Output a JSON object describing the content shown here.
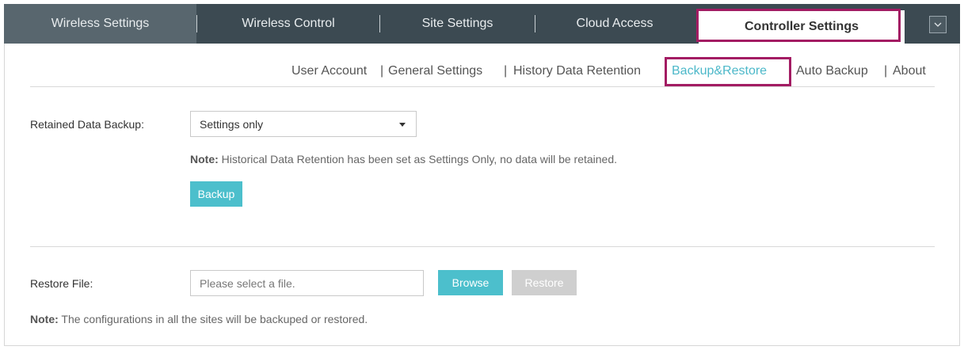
{
  "top_tabs": [
    {
      "label": "Wireless Settings"
    },
    {
      "label": "Wireless Control"
    },
    {
      "label": "Site Settings"
    },
    {
      "label": "Cloud Access"
    },
    {
      "label": "Controller Settings"
    }
  ],
  "top_tabs_active": "Controller Settings",
  "sub_nav": [
    {
      "label": "User Account"
    },
    {
      "label": "General Settings"
    },
    {
      "label": "History Data Retention"
    },
    {
      "label": "Backup&Restore"
    },
    {
      "label": "Auto Backup"
    },
    {
      "label": "About"
    }
  ],
  "sub_nav_active": "Backup&Restore",
  "backup": {
    "label": "Retained Data Backup:",
    "select_value": "Settings only",
    "note_prefix": "Note:",
    "note_text": "Historical Data Retention has been set as Settings Only, no data will be retained.",
    "button_label": "Backup"
  },
  "restore": {
    "label": "Restore File:",
    "input_placeholder": "Please select a file.",
    "browse_label": "Browse",
    "restore_label": "Restore",
    "note_prefix": "Note:",
    "note_text": "The configurations in all the sites will be backuped or restored."
  },
  "colors": {
    "topbar": "#3c4a52",
    "accent": "#4cbfcc",
    "highlight_outline": "#a31c63",
    "disabled": "#cfcfcf"
  }
}
